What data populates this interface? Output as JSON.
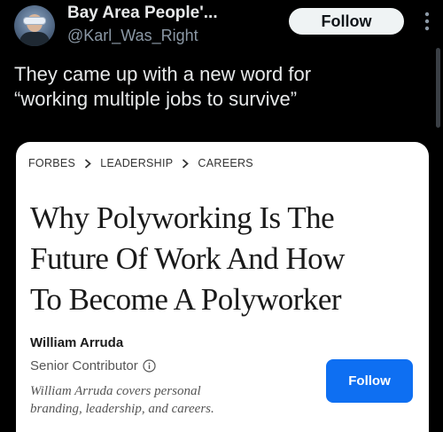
{
  "post": {
    "display_name": "Bay Area People'...",
    "handle": "@Karl_Was_Right",
    "follow_label": "Follow",
    "text_line1": "They came up with a new word for",
    "text_line2": "“working multiple jobs to survive”"
  },
  "card": {
    "breadcrumb": [
      "FORBES",
      "LEADERSHIP",
      "CAREERS"
    ],
    "headline_line1": "Why Polyworking Is The",
    "headline_line2": "Future Of Work And How",
    "headline_line3": "To Become A Polyworker",
    "author_name": "William Arruda",
    "author_role": "Senior Contributor",
    "author_bio_line1": "William Arruda covers personal",
    "author_bio_line2": "branding, leadership, and careers.",
    "follow_label": "Follow"
  },
  "colors": {
    "background": "#000000",
    "follow_button_bg": "#eff3f4",
    "card_follow_blue": "#0e6ff2"
  },
  "icons": [
    "more-vertical-icon",
    "chevron-right-icon",
    "info-icon"
  ]
}
